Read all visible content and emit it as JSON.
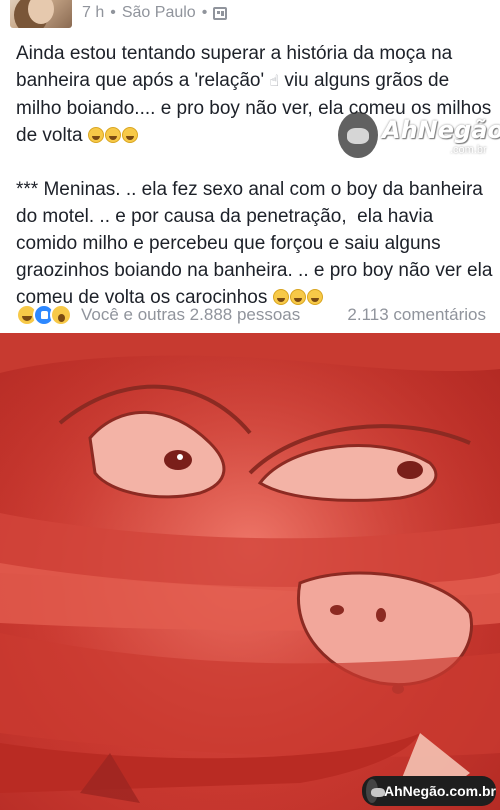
{
  "post": {
    "time": "7 h",
    "separator": "•",
    "location": "São Paulo",
    "separator2": "•",
    "paragraph1": {
      "text_before_icon": "Ainda estou tentando superar a história da moça na banheira que após a 'relação' ",
      "icon": "pointing-hand-icon",
      "text_after_icon": " viu alguns grãos de milho boiando.... e pro boy não ver, ela comeu os milhos de volta ",
      "trailing_emojis": [
        "laughing-emoji",
        "laughing-emoji",
        "laughing-emoji"
      ]
    },
    "paragraph2": {
      "text": "*** Meninas. .. ela fez sexo anal com o boy da banheira do motel. .. e por causa da penetração,  ela havia comido milho e percebeu que forçou e saiu alguns graozinhos boiando na banheira. .. e pro boy não ver ela comeu de volta os carocinhos ",
      "trailing_emojis": [
        "laughing-emoji",
        "laughing-emoji",
        "laughing-emoji"
      ]
    }
  },
  "reactions": {
    "icons": [
      "haha-reaction-icon",
      "like-reaction-icon",
      "wow-reaction-icon"
    ],
    "summary": "Você e outras 2.888 pessoas",
    "comments": "2.113 comentários"
  },
  "watermark": {
    "brand": "AhNegão!",
    "sub": ".com.br",
    "bottom": "AhNegão.com.br"
  },
  "colors": {
    "meta_gray": "#90949c",
    "text": "#1d2129",
    "image_red": "#cd3b32",
    "like_blue": "#2d88ff"
  }
}
